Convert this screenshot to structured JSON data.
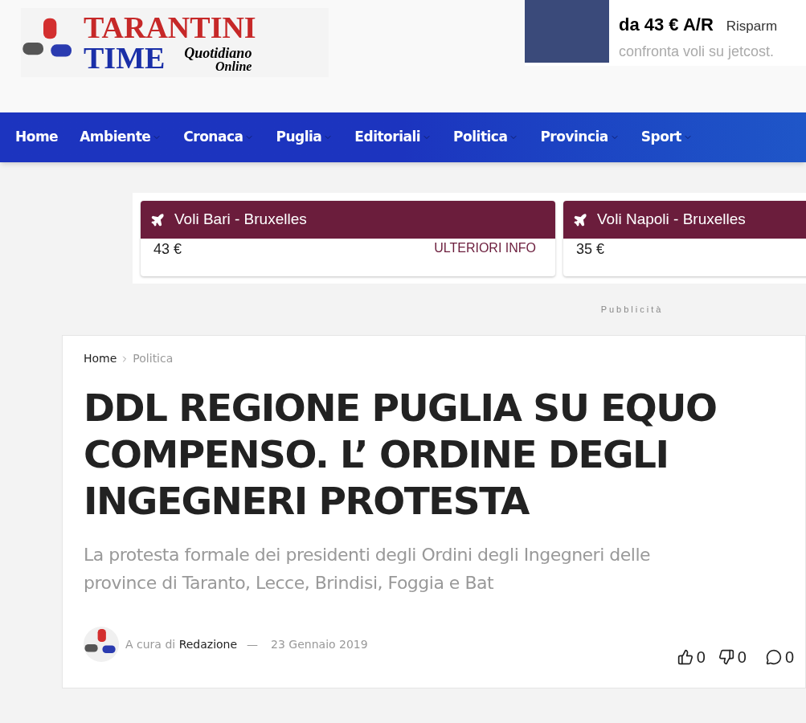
{
  "logo": {
    "line1": "TARANTINI",
    "line2": "TIME",
    "tagline1": "Quotidiano",
    "tagline2": "Online"
  },
  "top_ad": {
    "price": "da 43 € A/R",
    "extra": "Risparm",
    "subtitle": "confronta voli su jetcost."
  },
  "nav": [
    {
      "label": "Home",
      "has_menu": false
    },
    {
      "label": "Ambiente",
      "has_menu": true
    },
    {
      "label": "Cronaca",
      "has_menu": true
    },
    {
      "label": "Puglia",
      "has_menu": true
    },
    {
      "label": "Editoriali",
      "has_menu": true
    },
    {
      "label": "Politica",
      "has_menu": true
    },
    {
      "label": "Provincia",
      "has_menu": true
    },
    {
      "label": "Sport",
      "has_menu": true
    }
  ],
  "flight_cards": [
    {
      "title": "Voli Bari - Bruxelles",
      "price": "43 €",
      "link": "ULTERIORI INFO"
    },
    {
      "title": "Voli Napoli - Bruxelles",
      "price": "35 €"
    }
  ],
  "ad_label": "Pubblicità",
  "breadcrumb": [
    "Home",
    "Politica"
  ],
  "article": {
    "title": "DDL REGIONE PUGLIA SU EQUO COMPENSO. L’ ORDINE DEGLI INGEGNERI PROTESTA",
    "subtitle": "La protesta formale dei presidenti degli Ordini degli Ingegneri delle province di Taranto, Lecce, Brindisi, Foggia e Bat",
    "byline_prefix": "A cura di",
    "author": "Redazione",
    "separator": "—",
    "date": "23 Gennaio 2019",
    "likes": "0",
    "dislikes": "0",
    "comments": "0"
  }
}
